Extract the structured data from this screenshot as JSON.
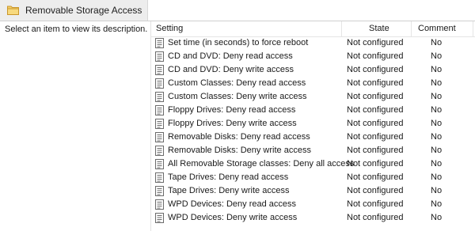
{
  "window": {
    "title": "Removable Storage Access"
  },
  "left_pane": {
    "description": "Select an item to view its description."
  },
  "columns": {
    "setting": "Setting",
    "state": "State",
    "comment": "Comment"
  },
  "rows": [
    {
      "setting": "Set time (in seconds) to force reboot",
      "state": "Not configured",
      "comment": "No"
    },
    {
      "setting": "CD and DVD: Deny read access",
      "state": "Not configured",
      "comment": "No"
    },
    {
      "setting": "CD and DVD: Deny write access",
      "state": "Not configured",
      "comment": "No"
    },
    {
      "setting": "Custom Classes: Deny read access",
      "state": "Not configured",
      "comment": "No"
    },
    {
      "setting": "Custom Classes: Deny write access",
      "state": "Not configured",
      "comment": "No"
    },
    {
      "setting": "Floppy Drives: Deny read access",
      "state": "Not configured",
      "comment": "No"
    },
    {
      "setting": "Floppy Drives: Deny write access",
      "state": "Not configured",
      "comment": "No"
    },
    {
      "setting": "Removable Disks: Deny read access",
      "state": "Not configured",
      "comment": "No"
    },
    {
      "setting": "Removable Disks: Deny write access",
      "state": "Not configured",
      "comment": "No"
    },
    {
      "setting": "All Removable Storage classes: Deny all access",
      "state": "Not configured",
      "comment": "No"
    },
    {
      "setting": "Tape Drives: Deny read access",
      "state": "Not configured",
      "comment": "No"
    },
    {
      "setting": "Tape Drives: Deny write access",
      "state": "Not configured",
      "comment": "No"
    },
    {
      "setting": "WPD Devices: Deny read access",
      "state": "Not configured",
      "comment": "No"
    },
    {
      "setting": "WPD Devices: Deny write access",
      "state": "Not configured",
      "comment": "No"
    }
  ],
  "icons": {
    "title": "folder-icon",
    "row": "policy-setting-icon"
  },
  "colors": {
    "folder": "#e8b84a",
    "header_separator": "#e5e5e5"
  }
}
